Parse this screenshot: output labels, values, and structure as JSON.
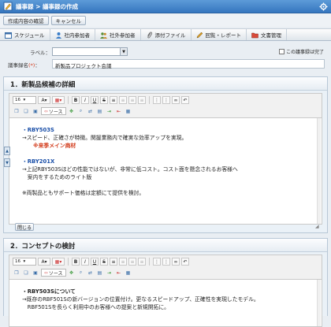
{
  "title": "議事録 > 議事録の作成",
  "actions": {
    "confirm": "作成内容の確認",
    "cancel": "キャンセル"
  },
  "tabs": [
    {
      "label": "スケジュール",
      "icon": "calendar-icon"
    },
    {
      "label": "社内参加者",
      "icon": "user-icon"
    },
    {
      "label": "社外参加者",
      "icon": "users-icon"
    },
    {
      "label": "添付ファイル",
      "icon": "paperclip-icon"
    },
    {
      "label": "回覧・レポート",
      "icon": "pencil-icon"
    },
    {
      "label": "文書管理",
      "icon": "folder-icon"
    }
  ],
  "form": {
    "label_label": "ラベル：",
    "name_label": "議事録名",
    "required": "(*)",
    "colon": "：",
    "name_value": "新製品プロジェクト会議",
    "complete_label": "この議事録は完了"
  },
  "toolbar": {
    "font_size": "16",
    "source": "ソース"
  },
  "sections": [
    {
      "heading": "1．新製品候補の詳細",
      "lines": [
        {
          "text": "・RBY503S",
          "style": "blue"
        },
        {
          "text": "→スピード、正確さが特徴。関援業務内で確実な効率アップを実現。",
          "style": ""
        },
        {
          "text": "※来季メイン商材",
          "style": "red"
        },
        {
          "text": "",
          "style": ""
        },
        {
          "text": "・RBY201X",
          "style": "blue"
        },
        {
          "text": "→上記RBY503Sほどの性能ではないが、非常に低コスト。コスト面を懸念されるお客様へ",
          "style": ""
        },
        {
          "text": "　案内をするためのライト版",
          "style": ""
        },
        {
          "text": "",
          "style": ""
        },
        {
          "text": "※両製品ともサポート価格は定額にて提供を検討。",
          "style": ""
        }
      ],
      "close": "閉じる"
    },
    {
      "heading": "2．コンセプトの検討",
      "lines": [
        {
          "text": "・RBY503Sについて",
          "style": "bold"
        },
        {
          "text": "→既存のRBF501Sの新バージョンの位置付け。更なるスピードアップ、正確性を実現したモデル。",
          "style": ""
        },
        {
          "text": "　RBF501Sを長らく利用中のお客様への提案と新規開拓に。",
          "style": ""
        }
      ]
    }
  ]
}
